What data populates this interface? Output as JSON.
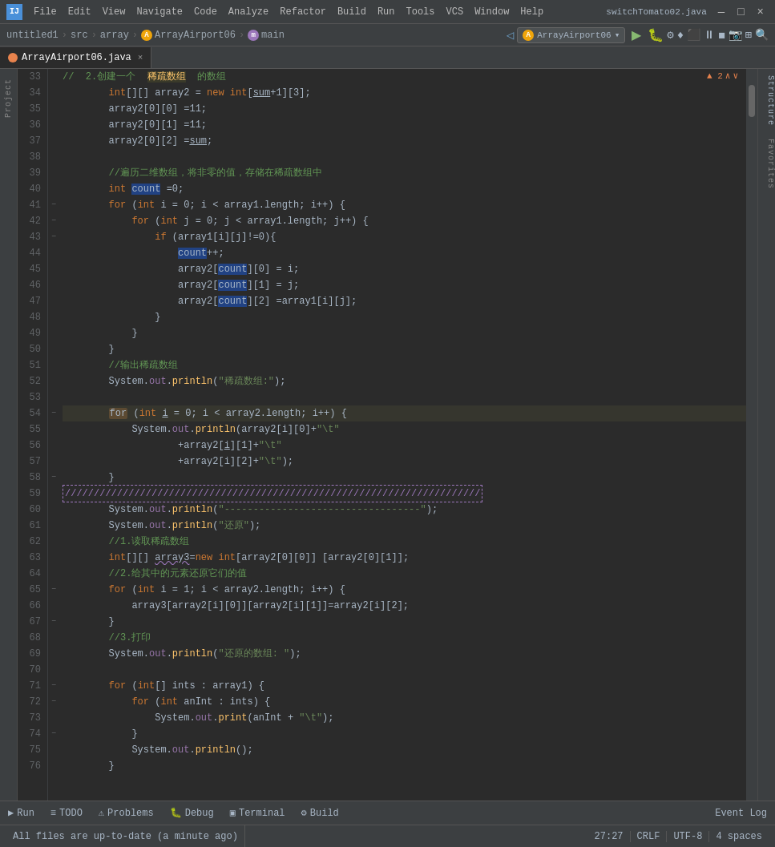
{
  "titlebar": {
    "logo": "IJ",
    "menu": [
      "File",
      "Edit",
      "View",
      "Navigate",
      "Code",
      "Analyze",
      "Refactor",
      "Build",
      "Run",
      "Tools",
      "VCS",
      "Window",
      "Help"
    ],
    "switch_label": "switchTomato02.java",
    "controls": [
      "—",
      "□",
      "×"
    ]
  },
  "navbar": {
    "breadcrumb": [
      "untitled1",
      "src",
      "array",
      "ArrayAirport06",
      "main"
    ],
    "run_config": "ArrayAirport06",
    "buttons": [
      "▶",
      "🐛",
      "⚙",
      "♦",
      "⬛",
      "⏸",
      "◼",
      "📷",
      "⊞"
    ]
  },
  "tabs": [
    {
      "label": "ArrayAirport06.java",
      "active": true
    }
  ],
  "editor": {
    "warning_count": "▲ 2",
    "lines": [
      {
        "num": "33",
        "fold": false,
        "content": "comment",
        "text": "//  2.创建一个  稀疏数组  的数组",
        "type": "comment-cn"
      },
      {
        "num": "34",
        "fold": false,
        "content": "code",
        "text": "        int[][] array2 = new int[sum+1][3];",
        "type": "mixed"
      },
      {
        "num": "35",
        "fold": false,
        "content": "code",
        "text": "        array2[0][0] =11;",
        "type": "mixed"
      },
      {
        "num": "36",
        "fold": false,
        "content": "code",
        "text": "        array2[0][1] =11;",
        "type": "mixed"
      },
      {
        "num": "37",
        "fold": false,
        "content": "code",
        "text": "        array2[0][2] =sum;",
        "type": "mixed"
      },
      {
        "num": "38",
        "fold": false,
        "content": "empty",
        "text": "",
        "type": "normal"
      },
      {
        "num": "39",
        "fold": false,
        "content": "comment",
        "text": "//遍历二维数组，将非零的值，存储在稀疏数组中",
        "type": "comment-cn"
      },
      {
        "num": "40",
        "fold": false,
        "content": "code",
        "text": "        int count =0;",
        "type": "mixed"
      },
      {
        "num": "41",
        "fold": true,
        "content": "code",
        "text": "        for (int i = 0; i < array1.length; i++) {",
        "type": "mixed"
      },
      {
        "num": "42",
        "fold": true,
        "content": "code",
        "text": "            for (int j = 0; j < array1.length; j++) {",
        "type": "mixed"
      },
      {
        "num": "43",
        "fold": true,
        "content": "code",
        "text": "                if (array1[i][j]!=0){",
        "type": "mixed"
      },
      {
        "num": "44",
        "fold": false,
        "content": "code",
        "text": "                    count++;",
        "type": "mixed"
      },
      {
        "num": "45",
        "fold": false,
        "content": "code",
        "text": "                    array2[count][0] = i;",
        "type": "mixed"
      },
      {
        "num": "46",
        "fold": false,
        "content": "code",
        "text": "                    array2[count][1] = j;",
        "type": "mixed"
      },
      {
        "num": "47",
        "fold": false,
        "content": "code",
        "text": "                    array2[count][2] =array1[i][j];",
        "type": "mixed"
      },
      {
        "num": "48",
        "fold": false,
        "content": "code",
        "text": "                }",
        "type": "normal"
      },
      {
        "num": "49",
        "fold": false,
        "content": "code",
        "text": "            }",
        "type": "normal"
      },
      {
        "num": "50",
        "fold": false,
        "content": "code",
        "text": "        }",
        "type": "normal"
      },
      {
        "num": "51",
        "fold": false,
        "content": "comment",
        "text": "//输出稀疏数组",
        "type": "comment-cn"
      },
      {
        "num": "52",
        "fold": false,
        "content": "code",
        "text": "        System.out.println(\"稀疏数组:\");",
        "type": "mixed"
      },
      {
        "num": "53",
        "fold": false,
        "content": "empty",
        "text": "",
        "type": "normal"
      },
      {
        "num": "54",
        "fold": true,
        "content": "code",
        "text": "        for (int i = 0; i < array2.length; i++) {",
        "type": "mixed",
        "highlighted": true
      },
      {
        "num": "55",
        "fold": false,
        "content": "code",
        "text": "            System.out.println(array2[i][0]+\"\\t\"",
        "type": "mixed"
      },
      {
        "num": "56",
        "fold": false,
        "content": "code",
        "text": "                    +array2[i][1]+\"\\t\"",
        "type": "mixed"
      },
      {
        "num": "57",
        "fold": false,
        "content": "code",
        "text": "                    +array2[i][2]+\"\\t\");",
        "type": "mixed"
      },
      {
        "num": "58",
        "fold": true,
        "content": "code",
        "text": "        }",
        "type": "normal"
      },
      {
        "num": "59",
        "fold": false,
        "content": "dashed",
        "text": "////////////////////////////////////////////////////////////////////////",
        "type": "dashed"
      },
      {
        "num": "60",
        "fold": false,
        "content": "code",
        "text": "        System.out.println(\"----------------------------------\");",
        "type": "mixed"
      },
      {
        "num": "61",
        "fold": false,
        "content": "code",
        "text": "        System.out.println(\"还原\");",
        "type": "mixed"
      },
      {
        "num": "62",
        "fold": false,
        "content": "comment",
        "text": "        //1.读取稀疏数组",
        "type": "comment-cn"
      },
      {
        "num": "63",
        "fold": false,
        "content": "code",
        "text": "        int[][] array3=new int[array2[0][0]] [array2[0][1]];",
        "type": "mixed"
      },
      {
        "num": "64",
        "fold": false,
        "content": "comment",
        "text": "        //2.给其中的元素还原它们的值",
        "type": "comment-cn"
      },
      {
        "num": "65",
        "fold": true,
        "content": "code",
        "text": "        for (int i = 1; i < array2.length; i++) {",
        "type": "mixed"
      },
      {
        "num": "66",
        "fold": false,
        "content": "code",
        "text": "            array3[array2[i][0]][array2[i][1]]=array2[i][2];",
        "type": "mixed"
      },
      {
        "num": "67",
        "fold": true,
        "content": "code",
        "text": "        }",
        "type": "normal"
      },
      {
        "num": "68",
        "fold": false,
        "content": "comment",
        "text": "        //3.打印",
        "type": "comment-cn"
      },
      {
        "num": "69",
        "fold": false,
        "content": "code",
        "text": "        System.out.println(\"还原的数组: \");",
        "type": "mixed"
      },
      {
        "num": "70",
        "fold": false,
        "content": "empty",
        "text": "",
        "type": "normal"
      },
      {
        "num": "71",
        "fold": true,
        "content": "code",
        "text": "        for (int[] ints : array1) {",
        "type": "mixed"
      },
      {
        "num": "72",
        "fold": true,
        "content": "code",
        "text": "            for (int anInt : ints) {",
        "type": "mixed"
      },
      {
        "num": "73",
        "fold": false,
        "content": "code",
        "text": "                System.out.print(anInt + \"\\t\");",
        "type": "mixed"
      },
      {
        "num": "74",
        "fold": true,
        "content": "code",
        "text": "            }",
        "type": "normal"
      },
      {
        "num": "75",
        "fold": false,
        "content": "code",
        "text": "            System.out.println();",
        "type": "mixed"
      },
      {
        "num": "76",
        "fold": false,
        "content": "code",
        "text": "        }",
        "type": "normal"
      }
    ]
  },
  "bottom_toolbar": {
    "items": [
      {
        "icon": "▶",
        "label": "Run"
      },
      {
        "icon": "≡",
        "label": "TODO"
      },
      {
        "icon": "⚠",
        "label": "Problems"
      },
      {
        "icon": "🐛",
        "label": "Debug"
      },
      {
        "icon": "▣",
        "label": "Terminal"
      },
      {
        "icon": "⚙",
        "label": "Build"
      }
    ],
    "event_log": "Event Log"
  },
  "statusbar": {
    "message": "All files are up-to-date (a minute ago)",
    "position": "27:27",
    "line_sep": "CRLF",
    "encoding": "UTF-8",
    "indent": "4 spaces"
  },
  "side_panels": {
    "project": "Project",
    "structure": "Structure",
    "favorites": "Favorites"
  }
}
